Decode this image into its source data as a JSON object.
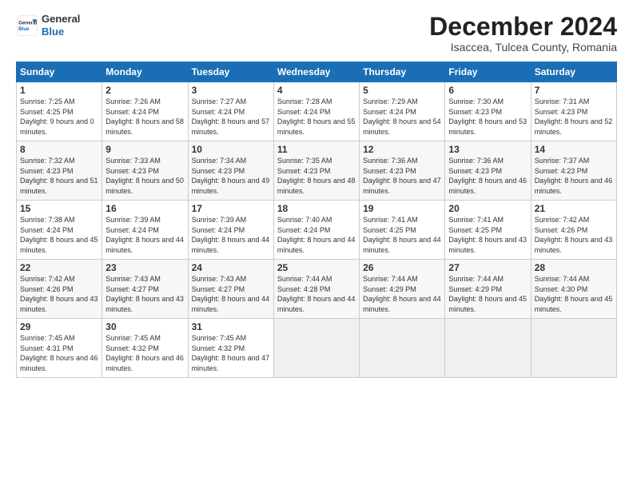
{
  "logo": {
    "line1": "General",
    "line2": "Blue"
  },
  "title": "December 2024",
  "subtitle": "Isaccea, Tulcea County, Romania",
  "days_of_week": [
    "Sunday",
    "Monday",
    "Tuesday",
    "Wednesday",
    "Thursday",
    "Friday",
    "Saturday"
  ],
  "weeks": [
    [
      {
        "day": 1,
        "sunrise": "7:25 AM",
        "sunset": "4:25 PM",
        "daylight": "9 hours and 0 minutes."
      },
      {
        "day": 2,
        "sunrise": "7:26 AM",
        "sunset": "4:24 PM",
        "daylight": "8 hours and 58 minutes."
      },
      {
        "day": 3,
        "sunrise": "7:27 AM",
        "sunset": "4:24 PM",
        "daylight": "8 hours and 57 minutes."
      },
      {
        "day": 4,
        "sunrise": "7:28 AM",
        "sunset": "4:24 PM",
        "daylight": "8 hours and 55 minutes."
      },
      {
        "day": 5,
        "sunrise": "7:29 AM",
        "sunset": "4:24 PM",
        "daylight": "8 hours and 54 minutes."
      },
      {
        "day": 6,
        "sunrise": "7:30 AM",
        "sunset": "4:23 PM",
        "daylight": "8 hours and 53 minutes."
      },
      {
        "day": 7,
        "sunrise": "7:31 AM",
        "sunset": "4:23 PM",
        "daylight": "8 hours and 52 minutes."
      }
    ],
    [
      {
        "day": 8,
        "sunrise": "7:32 AM",
        "sunset": "4:23 PM",
        "daylight": "8 hours and 51 minutes."
      },
      {
        "day": 9,
        "sunrise": "7:33 AM",
        "sunset": "4:23 PM",
        "daylight": "8 hours and 50 minutes."
      },
      {
        "day": 10,
        "sunrise": "7:34 AM",
        "sunset": "4:23 PM",
        "daylight": "8 hours and 49 minutes."
      },
      {
        "day": 11,
        "sunrise": "7:35 AM",
        "sunset": "4:23 PM",
        "daylight": "8 hours and 48 minutes."
      },
      {
        "day": 12,
        "sunrise": "7:36 AM",
        "sunset": "4:23 PM",
        "daylight": "8 hours and 47 minutes."
      },
      {
        "day": 13,
        "sunrise": "7:36 AM",
        "sunset": "4:23 PM",
        "daylight": "8 hours and 46 minutes."
      },
      {
        "day": 14,
        "sunrise": "7:37 AM",
        "sunset": "4:23 PM",
        "daylight": "8 hours and 46 minutes."
      }
    ],
    [
      {
        "day": 15,
        "sunrise": "7:38 AM",
        "sunset": "4:24 PM",
        "daylight": "8 hours and 45 minutes."
      },
      {
        "day": 16,
        "sunrise": "7:39 AM",
        "sunset": "4:24 PM",
        "daylight": "8 hours and 44 minutes."
      },
      {
        "day": 17,
        "sunrise": "7:39 AM",
        "sunset": "4:24 PM",
        "daylight": "8 hours and 44 minutes."
      },
      {
        "day": 18,
        "sunrise": "7:40 AM",
        "sunset": "4:24 PM",
        "daylight": "8 hours and 44 minutes."
      },
      {
        "day": 19,
        "sunrise": "7:41 AM",
        "sunset": "4:25 PM",
        "daylight": "8 hours and 44 minutes."
      },
      {
        "day": 20,
        "sunrise": "7:41 AM",
        "sunset": "4:25 PM",
        "daylight": "8 hours and 43 minutes."
      },
      {
        "day": 21,
        "sunrise": "7:42 AM",
        "sunset": "4:26 PM",
        "daylight": "8 hours and 43 minutes."
      }
    ],
    [
      {
        "day": 22,
        "sunrise": "7:42 AM",
        "sunset": "4:26 PM",
        "daylight": "8 hours and 43 minutes."
      },
      {
        "day": 23,
        "sunrise": "7:43 AM",
        "sunset": "4:27 PM",
        "daylight": "8 hours and 43 minutes."
      },
      {
        "day": 24,
        "sunrise": "7:43 AM",
        "sunset": "4:27 PM",
        "daylight": "8 hours and 44 minutes."
      },
      {
        "day": 25,
        "sunrise": "7:44 AM",
        "sunset": "4:28 PM",
        "daylight": "8 hours and 44 minutes."
      },
      {
        "day": 26,
        "sunrise": "7:44 AM",
        "sunset": "4:29 PM",
        "daylight": "8 hours and 44 minutes."
      },
      {
        "day": 27,
        "sunrise": "7:44 AM",
        "sunset": "4:29 PM",
        "daylight": "8 hours and 45 minutes."
      },
      {
        "day": 28,
        "sunrise": "7:44 AM",
        "sunset": "4:30 PM",
        "daylight": "8 hours and 45 minutes."
      }
    ],
    [
      {
        "day": 29,
        "sunrise": "7:45 AM",
        "sunset": "4:31 PM",
        "daylight": "8 hours and 46 minutes."
      },
      {
        "day": 30,
        "sunrise": "7:45 AM",
        "sunset": "4:32 PM",
        "daylight": "8 hours and 46 minutes."
      },
      {
        "day": 31,
        "sunrise": "7:45 AM",
        "sunset": "4:32 PM",
        "daylight": "8 hours and 47 minutes."
      },
      null,
      null,
      null,
      null
    ]
  ]
}
